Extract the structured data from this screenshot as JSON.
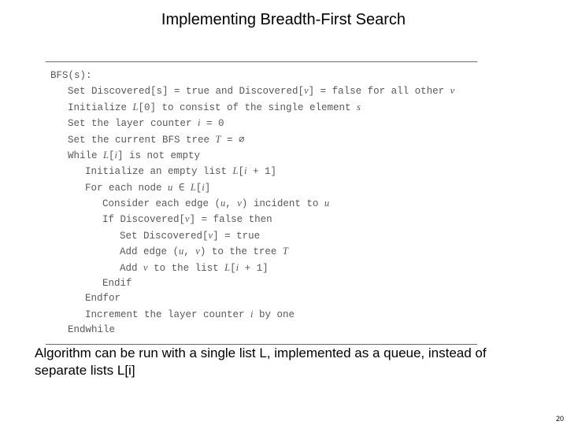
{
  "title": "Implementing Breadth-First Search",
  "algo": {
    "l0": "BFS(s):",
    "l1a": "Set Discovered[s] = true and Discovered[",
    "l1b": "v",
    "l1c": "] = false for all other ",
    "l1d": "v",
    "l2a": "Initialize ",
    "l2b": "L",
    "l2c": "[0] to consist of the single element ",
    "l2d": "s",
    "l3a": "Set the layer counter ",
    "l3b": "i",
    "l3c": " = 0",
    "l4a": "Set the current BFS tree ",
    "l4b": "T",
    "l4c": " = ∅",
    "l5a": "While ",
    "l5b": "L",
    "l5c": "[",
    "l5d": "i",
    "l5e": "] is not empty",
    "l6a": "Initialize an empty list ",
    "l6b": "L",
    "l6c": "[",
    "l6d": "i",
    "l6e": " + 1]",
    "l7a": "For each node ",
    "l7b": "u",
    "l7c": " ∈ ",
    "l7d": "L",
    "l7e": "[",
    "l7f": "i",
    "l7g": "]",
    "l8a": "Consider each edge (",
    "l8b": "u",
    "l8c": ", ",
    "l8d": "v",
    "l8e": ") incident to ",
    "l8f": "u",
    "l9a": "If Discovered[",
    "l9b": "v",
    "l9c": "] = false then",
    "l10a": "Set Discovered[",
    "l10b": "v",
    "l10c": "] = true",
    "l11a": "Add edge (",
    "l11b": "u",
    "l11c": ", ",
    "l11d": "v",
    "l11e": ") to the tree ",
    "l11f": "T",
    "l12a": "Add ",
    "l12b": "v",
    "l12c": " to the list ",
    "l12d": "L",
    "l12e": "[",
    "l12f": "i",
    "l12g": " + 1]",
    "l13": "Endif",
    "l14": "Endfor",
    "l15a": "Increment the layer counter ",
    "l15b": "i",
    "l15c": " by one",
    "l16": "Endwhile"
  },
  "caption": "Algorithm can be run with a single list L, implemented as a queue, instead of separate lists L[i]",
  "page": "20"
}
